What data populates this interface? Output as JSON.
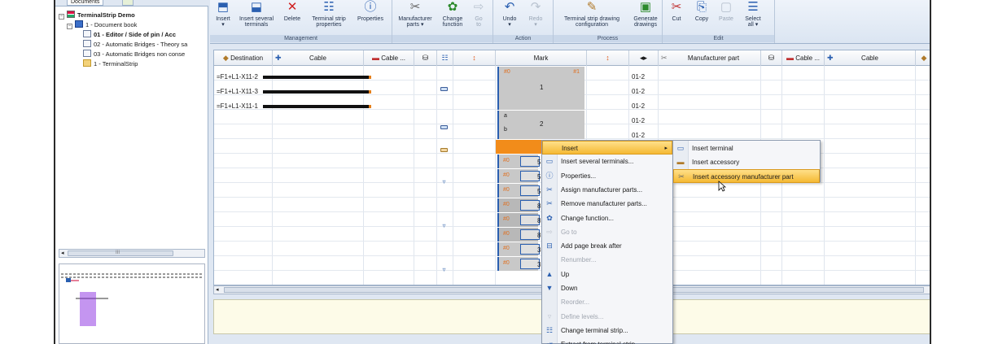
{
  "tree": {
    "tab_label": "Documents",
    "items": [
      {
        "label": "TerminalStrip Demo",
        "bold": true
      },
      {
        "label": "1 - Document book",
        "bold": false
      },
      {
        "label": "01 - Editor / Side of pin / Acc",
        "bold": true
      },
      {
        "label": "02 - Automatic Bridges - Theory sa",
        "bold": false
      },
      {
        "label": "03 - Automatic Bridges non conse",
        "bold": false
      },
      {
        "label": "1 - TerminalStrip",
        "bold": false
      }
    ],
    "scroll_label": "III"
  },
  "ribbon": {
    "groups": [
      {
        "title": "Management",
        "buttons": [
          {
            "label": "Insert\n▾",
            "icon": "insert-icon"
          },
          {
            "label": "Insert several\nterminals",
            "icon": "insert-several-icon"
          },
          {
            "label": "Delete",
            "icon": "delete-icon"
          },
          {
            "label": "Terminal strip\nproperties",
            "icon": "strip-properties-icon"
          },
          {
            "label": "Properties",
            "icon": "properties-icon"
          }
        ]
      },
      {
        "title": "",
        "buttons": [
          {
            "label": "Manufacturer\nparts ▾",
            "icon": "manufacturer-icon"
          },
          {
            "label": "Change\nfunction",
            "icon": "change-function-icon"
          },
          {
            "label": "Go\nto",
            "icon": "goto-icon"
          }
        ]
      },
      {
        "title": "Action",
        "buttons": [
          {
            "label": "Undo\n▾",
            "icon": "undo-icon"
          },
          {
            "label": "Redo\n▾",
            "icon": "redo-icon"
          }
        ]
      },
      {
        "title": "Process",
        "buttons": [
          {
            "label": "Terminal strip drawing\nconfiguration",
            "icon": "drawing-config-icon"
          },
          {
            "label": "Generate\ndrawings",
            "icon": "generate-icon"
          }
        ]
      },
      {
        "title": "Edit",
        "buttons": [
          {
            "label": "Cut",
            "icon": "cut-icon"
          },
          {
            "label": "Copy",
            "icon": "copy-icon"
          },
          {
            "label": "Paste",
            "icon": "paste-icon"
          },
          {
            "label": "Select\nall ▾",
            "icon": "select-all-icon"
          }
        ]
      }
    ]
  },
  "grid": {
    "headers": {
      "destination": "Destination",
      "cable": "Cable",
      "cable_dots": "Cable ...",
      "mark": "Mark",
      "manufacturer_part": "Manufacturer part",
      "cable_dots_2": "Cable ...",
      "cable_2": "Cable"
    },
    "rows": [
      {
        "destination": "=F1+L1-X11-2",
        "level": "01-2"
      },
      {
        "destination": "=F1+L1-X11-3",
        "level": "01-2"
      },
      {
        "destination": "=F1+L1-X11-1",
        "level": "01-2"
      },
      {
        "destination": "",
        "level": "01-2"
      },
      {
        "destination": "",
        "level": "01-2"
      }
    ],
    "marks": {
      "m1": "1",
      "m2": "2",
      "tag_0": "#0",
      "tag_1": "#1",
      "a": "a",
      "b": "b",
      "lower": [
        {
          "tag": "#0",
          "num": "5"
        },
        {
          "tag": "#0",
          "num": "5"
        },
        {
          "tag": "#0",
          "num": "5"
        },
        {
          "tag": "#0",
          "num": "8"
        },
        {
          "tag": "#0",
          "num": "8"
        },
        {
          "tag": "#0",
          "num": "8"
        },
        {
          "tag": "#0",
          "num": "3"
        },
        {
          "tag": "#0",
          "num": "3"
        }
      ]
    }
  },
  "context_menu": {
    "items": [
      {
        "label": "Insert",
        "icon": "insert-icon",
        "disabled": false,
        "highlight": true,
        "submenu": true
      },
      {
        "label": "Insert several terminals...",
        "icon": "terminal-icon",
        "disabled": false
      },
      {
        "label": "Properties...",
        "icon": "properties-icon",
        "disabled": false
      },
      {
        "label": "Assign manufacturer parts...",
        "icon": "assign-parts-icon",
        "disabled": false
      },
      {
        "label": "Remove manufacturer parts...",
        "icon": "remove-parts-icon",
        "disabled": false
      },
      {
        "label": "Change function...",
        "icon": "change-function-icon",
        "disabled": false
      },
      {
        "label": "Go to",
        "icon": "goto-icon",
        "disabled": true
      },
      {
        "label": "Add page break after",
        "icon": "page-break-icon",
        "disabled": false
      },
      {
        "label": "Renumber...",
        "icon": "",
        "disabled": true
      },
      {
        "label": "Up",
        "icon": "arrow-up-icon",
        "disabled": false
      },
      {
        "label": "Down",
        "icon": "arrow-down-icon",
        "disabled": false
      },
      {
        "label": "Reorder...",
        "icon": "",
        "disabled": true
      },
      {
        "label": "Define levels...",
        "icon": "levels-icon",
        "disabled": true
      },
      {
        "label": "Change terminal strip...",
        "icon": "change-strip-icon",
        "disabled": false
      },
      {
        "label": "Extract from terminal strip",
        "icon": "extract-icon",
        "disabled": false
      }
    ]
  },
  "submenu": {
    "items": [
      {
        "label": "Insert terminal",
        "icon": "terminal-icon",
        "highlight": false
      },
      {
        "label": "Insert accessory",
        "icon": "accessory-icon",
        "highlight": false
      },
      {
        "label": "Insert accessory manufacturer part",
        "icon": "accessory-part-icon",
        "highlight": true
      }
    ]
  },
  "colors": {
    "accent": "#2a5fb0",
    "highlight": "#f5b933",
    "orange_row": "#f28c1a",
    "cable_end": "#e57f1a"
  }
}
